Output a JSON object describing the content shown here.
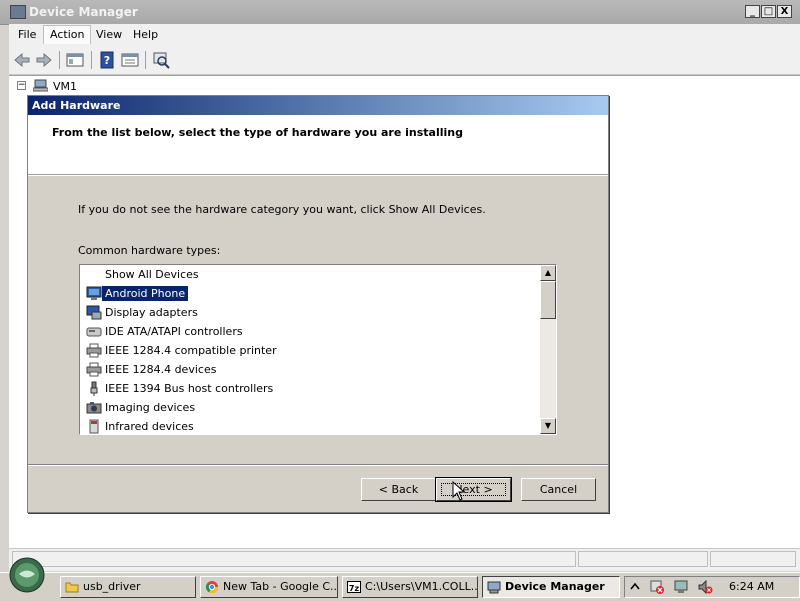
{
  "window": {
    "title": "Device Manager",
    "controls": {
      "minimize": "_",
      "maximize": "□",
      "close": "X"
    }
  },
  "menu": [
    "File",
    "Action",
    "View",
    "Help"
  ],
  "toolbar": {
    "icons": [
      "back-arrow-icon",
      "forward-arrow-icon",
      "properties-view-icon",
      "help-icon",
      "details-view-icon",
      "scan-hardware-icon"
    ]
  },
  "tree": {
    "root_label": "VM1",
    "expander": "−"
  },
  "dialog": {
    "title": "Add Hardware",
    "header": "From the list below, select the type of hardware you are installing",
    "info": "If you do not see the hardware category you want, click Show All Devices.",
    "list_label": "Common hardware types:",
    "items": [
      {
        "label": "Show All Devices",
        "icon": "none",
        "selected": false
      },
      {
        "label": "Android Phone",
        "icon": "monitor-icon",
        "selected": true
      },
      {
        "label": "Display adapters",
        "icon": "display-adapter-icon",
        "selected": false
      },
      {
        "label": "IDE ATA/ATAPI controllers",
        "icon": "ide-controller-icon",
        "selected": false
      },
      {
        "label": "IEEE 1284.4 compatible printer",
        "icon": "printer-icon",
        "selected": false
      },
      {
        "label": "IEEE 1284.4 devices",
        "icon": "printer-icon",
        "selected": false
      },
      {
        "label": "IEEE 1394 Bus host controllers",
        "icon": "firewire-icon",
        "selected": false
      },
      {
        "label": "Imaging devices",
        "icon": "camera-icon",
        "selected": false
      },
      {
        "label": "Infrared devices",
        "icon": "infrared-icon",
        "selected": false
      }
    ],
    "buttons": {
      "back": "< Back",
      "next": "Next >",
      "cancel": "Cancel"
    }
  },
  "taskbar": {
    "items": [
      {
        "label": "usb_driver",
        "icon": "folder-icon",
        "active": false
      },
      {
        "label": "New Tab - Google C...",
        "icon": "chrome-icon",
        "active": false
      },
      {
        "label": "C:\\Users\\VM1.COLL...",
        "icon": "7zip-icon",
        "active": false
      },
      {
        "label": "Device Manager",
        "icon": "device-manager-icon",
        "active": true
      }
    ],
    "tray_icons": [
      "chevron-up-icon",
      "network-warning-icon",
      "display-icon",
      "volume-muted-icon"
    ],
    "clock": "6:24 AM"
  },
  "colors": {
    "dialog_title_start": "#0a246a",
    "dialog_title_end": "#a6caf0",
    "selection": "#0a246a",
    "face": "#d4d0c8"
  }
}
